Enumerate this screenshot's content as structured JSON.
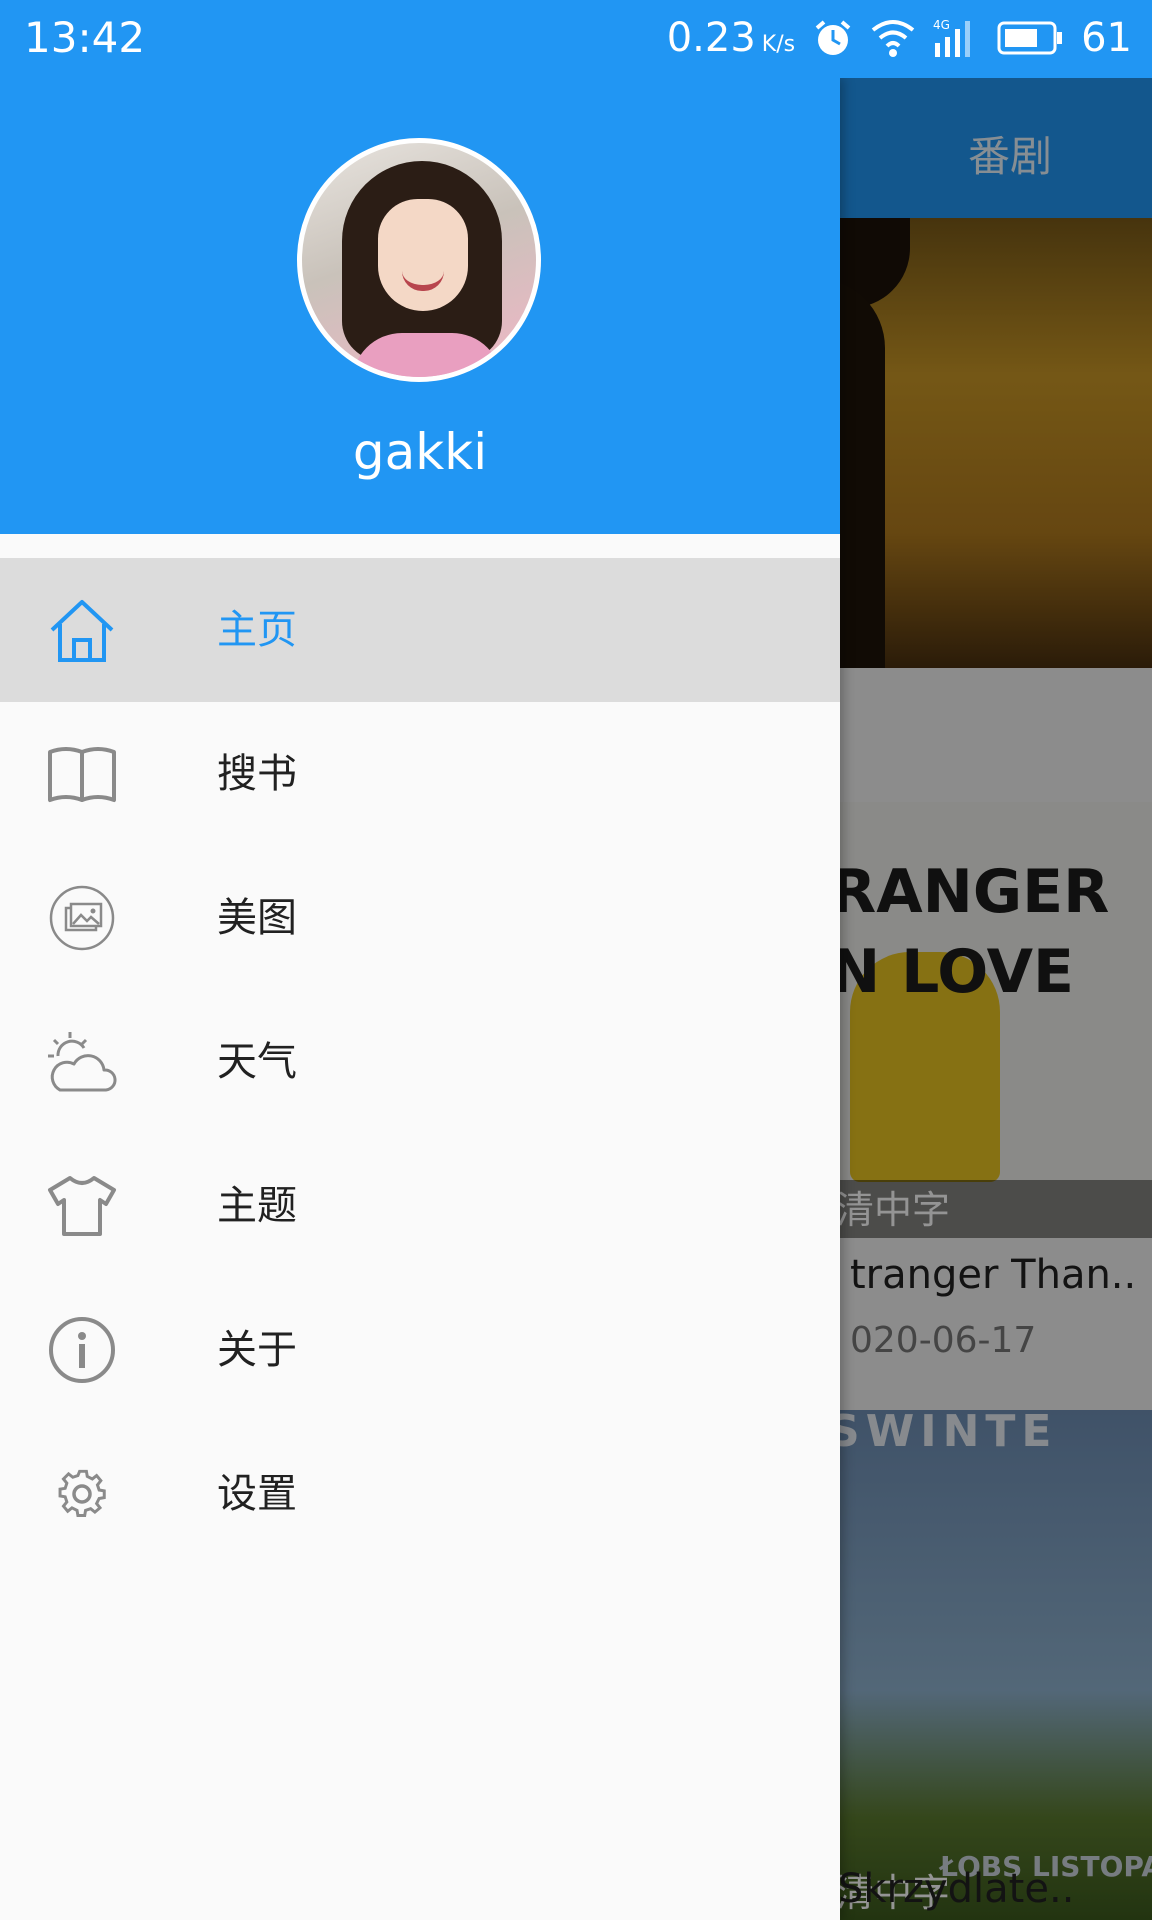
{
  "status_bar": {
    "time": "13:42",
    "net_speed": "0.23",
    "net_speed_unit": "K/s",
    "signal_label": "4G",
    "battery_level": "61"
  },
  "background": {
    "tab_label": "番剧",
    "poster_line1": "RANGER",
    "poster_line2": "N LOVE",
    "item1_caption": "清中字",
    "item1_title": "tranger Than..",
    "item1_date": "020-06-17",
    "item2_top_text": "SWINTE",
    "item2_logo_text": "ŁOBS LISTOPADA",
    "item2_caption": "清中字",
    "item2_title": "Skrzydlate.."
  },
  "drawer": {
    "username": "gakki",
    "menu": [
      {
        "label": "主页",
        "icon": "home-icon",
        "active": true
      },
      {
        "label": "搜书",
        "icon": "book-icon",
        "active": false
      },
      {
        "label": "美图",
        "icon": "image-icon",
        "active": false
      },
      {
        "label": "天气",
        "icon": "weather-icon",
        "active": false
      },
      {
        "label": "主题",
        "icon": "tshirt-icon",
        "active": false
      },
      {
        "label": "关于",
        "icon": "info-icon",
        "active": false
      },
      {
        "label": "设置",
        "icon": "gear-icon",
        "active": false
      }
    ]
  },
  "colors": {
    "primary": "#2196F3",
    "active_row": "#dcdcdc",
    "icon_gray": "#8a8a8a"
  }
}
